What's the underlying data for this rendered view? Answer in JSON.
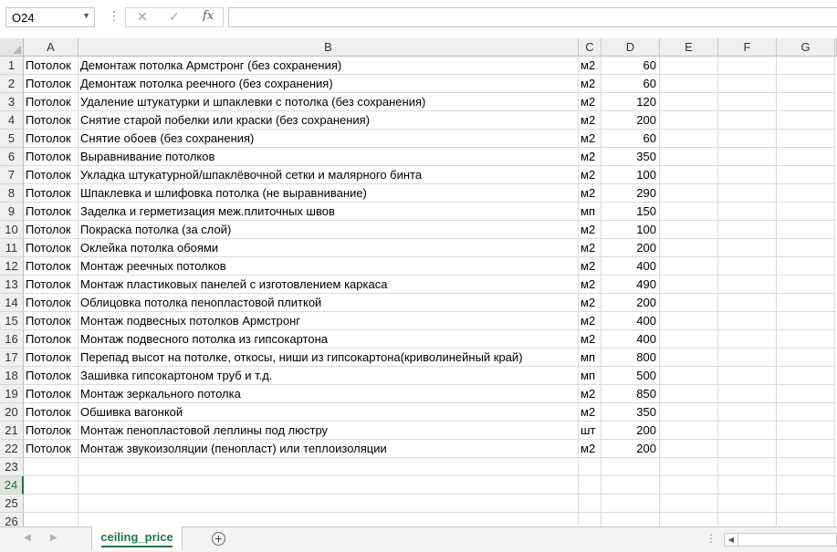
{
  "formula_bar": {
    "name_box": "O24",
    "name_box_arrow": "▼",
    "dots": "⋮",
    "cancel": "✕",
    "enter": "✓",
    "fx": "fx",
    "formula": ""
  },
  "columns": [
    "A",
    "B",
    "C",
    "D",
    "E",
    "F",
    "G"
  ],
  "rows": [
    {
      "n": "1",
      "a": "Потолок",
      "b": "Демонтаж потолка Армстронг (без сохранения)",
      "c": "м2",
      "d": "60"
    },
    {
      "n": "2",
      "a": "Потолок",
      "b": "Демонтаж потолка реечного (без сохранения)",
      "c": "м2",
      "d": "60"
    },
    {
      "n": "3",
      "a": "Потолок",
      "b": "Удаление штукатурки и шпаклевки с потолка (без сохранения)",
      "c": "м2",
      "d": "120"
    },
    {
      "n": "4",
      "a": "Потолок",
      "b": "Снятие старой побелки или краски (без сохранения)",
      "c": "м2",
      "d": "200"
    },
    {
      "n": "5",
      "a": "Потолок",
      "b": "Снятие обоев (без сохранения)",
      "c": "м2",
      "d": "60"
    },
    {
      "n": "6",
      "a": "Потолок",
      "b": "Выравнивание потолков",
      "c": "м2",
      "d": "350"
    },
    {
      "n": "7",
      "a": "Потолок",
      "b": "Укладка штукатурной/шпаклёвочной сетки и малярного бинта",
      "c": "м2",
      "d": "100"
    },
    {
      "n": "8",
      "a": "Потолок",
      "b": "Шпаклевка и шлифовка потолка (не выравнивание)",
      "c": "м2",
      "d": "290"
    },
    {
      "n": "9",
      "a": "Потолок",
      "b": "Заделка и герметизация меж.плиточных швов",
      "c": "мп",
      "d": "150"
    },
    {
      "n": "10",
      "a": "Потолок",
      "b": "Покраска потолка (за слой)",
      "c": "м2",
      "d": "100"
    },
    {
      "n": "11",
      "a": "Потолок",
      "b": "Оклейка потолка обоями",
      "c": "м2",
      "d": "200"
    },
    {
      "n": "12",
      "a": "Потолок",
      "b": "Монтаж реечных потолков",
      "c": "м2",
      "d": "400"
    },
    {
      "n": "13",
      "a": "Потолок",
      "b": "Монтаж пластиковых панелей с изготовлением каркаса",
      "c": "м2",
      "d": "490"
    },
    {
      "n": "14",
      "a": "Потолок",
      "b": "Облицовка потолка пенопластовой плиткой",
      "c": "м2",
      "d": "200"
    },
    {
      "n": "15",
      "a": "Потолок",
      "b": "Монтаж подвесных потолков Армстронг",
      "c": "м2",
      "d": "400"
    },
    {
      "n": "16",
      "a": "Потолок",
      "b": "Монтаж подвесного потолка из гипсокартона",
      "c": "м2",
      "d": "400"
    },
    {
      "n": "17",
      "a": "Потолок",
      "b": "Перепад высот на потолке, откосы, ниши из гипсокартона(криволинейный край)",
      "c": "мп",
      "d": "800"
    },
    {
      "n": "18",
      "a": "Потолок",
      "b": "Зашивка гипсокартоном труб и т.д.",
      "c": "мп",
      "d": "500"
    },
    {
      "n": "19",
      "a": "Потолок",
      "b": "Монтаж зеркального потолка",
      "c": "м2",
      "d": "850"
    },
    {
      "n": "20",
      "a": "Потолок",
      "b": "Обшивка вагонкой",
      "c": "м2",
      "d": "350"
    },
    {
      "n": "21",
      "a": "Потолок",
      "b": "Монтаж пенопластовой леплины под люстру",
      "c": "шт",
      "d": "200"
    },
    {
      "n": "22",
      "a": "Потолок",
      "b": "Монтаж звукоизоляции (пенопласт) или теплоизоляции",
      "c": "м2",
      "d": "200"
    },
    {
      "n": "23",
      "a": "",
      "b": "",
      "c": "",
      "d": ""
    },
    {
      "n": "24",
      "a": "",
      "b": "",
      "c": "",
      "d": ""
    },
    {
      "n": "25",
      "a": "",
      "b": "",
      "c": "",
      "d": ""
    },
    {
      "n": "26",
      "a": "",
      "b": "",
      "c": "",
      "d": ""
    }
  ],
  "active_row": "24",
  "sheet_tab": "ceiling_price",
  "bottom": {
    "prev": "◀",
    "next": "▶",
    "add": "+",
    "dots": "⋮",
    "scroll_left": "◀"
  },
  "colors": {
    "accent": "#217346"
  }
}
